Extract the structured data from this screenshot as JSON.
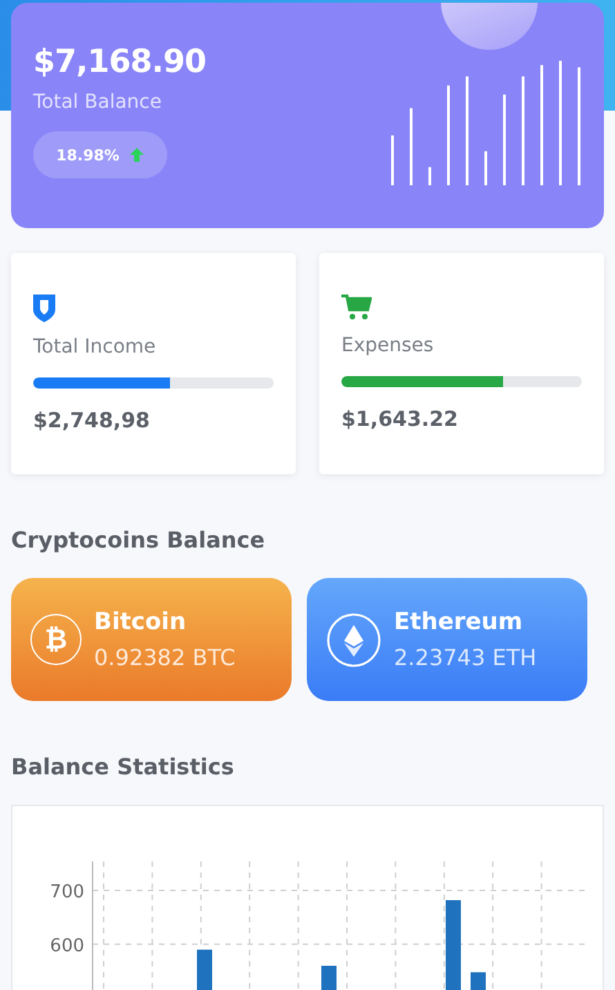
{
  "balance": {
    "amount": "$7,168.90",
    "label": "Total Balance",
    "change": "18.98%"
  },
  "summary": [
    {
      "kind": "income",
      "label": "Total Income",
      "level": 0.57,
      "amount": "$2,748,98",
      "color": "#1a7cf5"
    },
    {
      "kind": "expenses",
      "label": "Expenses",
      "level": 0.67,
      "amount": "$1,643.22",
      "color": "#28a745"
    }
  ],
  "crypto_title": "Cryptocoins Balance",
  "coins": [
    {
      "kind": "bitcoin",
      "symbol": "₿",
      "name": "Bitcoin",
      "amount": "0.92382 BTC"
    },
    {
      "kind": "ethereum",
      "name": "Ethereum",
      "amount": "2.23743 ETH"
    }
  ],
  "stats": {
    "title": "Balance Statistics",
    "chart_data": {
      "type": "bar",
      "grid": true,
      "ylim": [
        515,
        754
      ],
      "yticks": [
        600,
        700
      ],
      "values": [
        null,
        null,
        null,
        null,
        590,
        null,
        null,
        null,
        null,
        560,
        null,
        null,
        null,
        null,
        682,
        548,
        null,
        null,
        null,
        null
      ]
    }
  }
}
